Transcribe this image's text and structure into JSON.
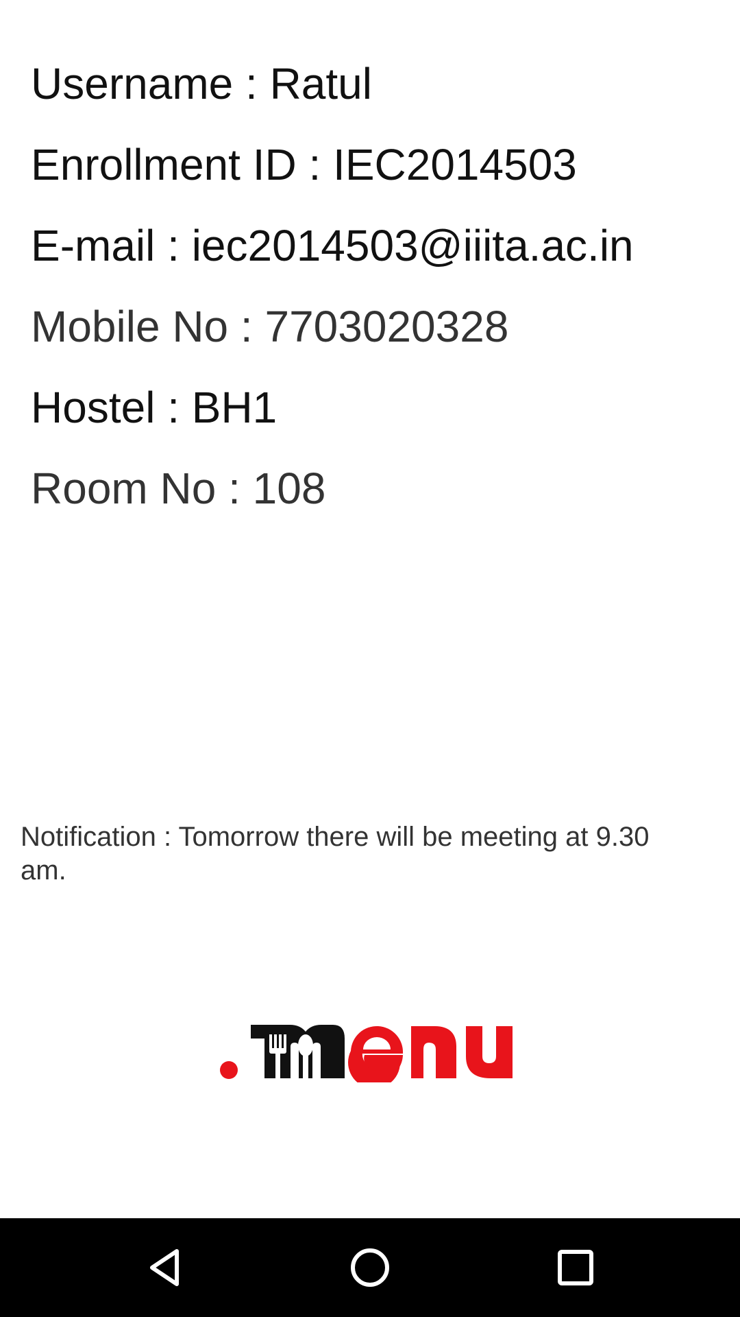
{
  "profile": {
    "username": "Username : Ratul",
    "enrollment": "Enrollment ID : IEC2014503",
    "email": "E-mail : iec2014503@iiita.ac.in",
    "mobile": "Mobile No : 7703020328",
    "hostel": "Hostel : BH1",
    "room": "Room No : 108"
  },
  "notification": {
    "text": "Notification : Tomorrow there will be meeting at 9.30 am."
  },
  "logo": {
    "text": ".menu",
    "colors": {
      "dot": "#e8141b",
      "m": "#111111",
      "enu": "#e8141b"
    }
  },
  "navbar": {
    "background": "#000000",
    "buttons": [
      {
        "icon": "back-triangle-icon"
      },
      {
        "icon": "home-circle-icon"
      },
      {
        "icon": "recents-square-icon"
      }
    ]
  }
}
